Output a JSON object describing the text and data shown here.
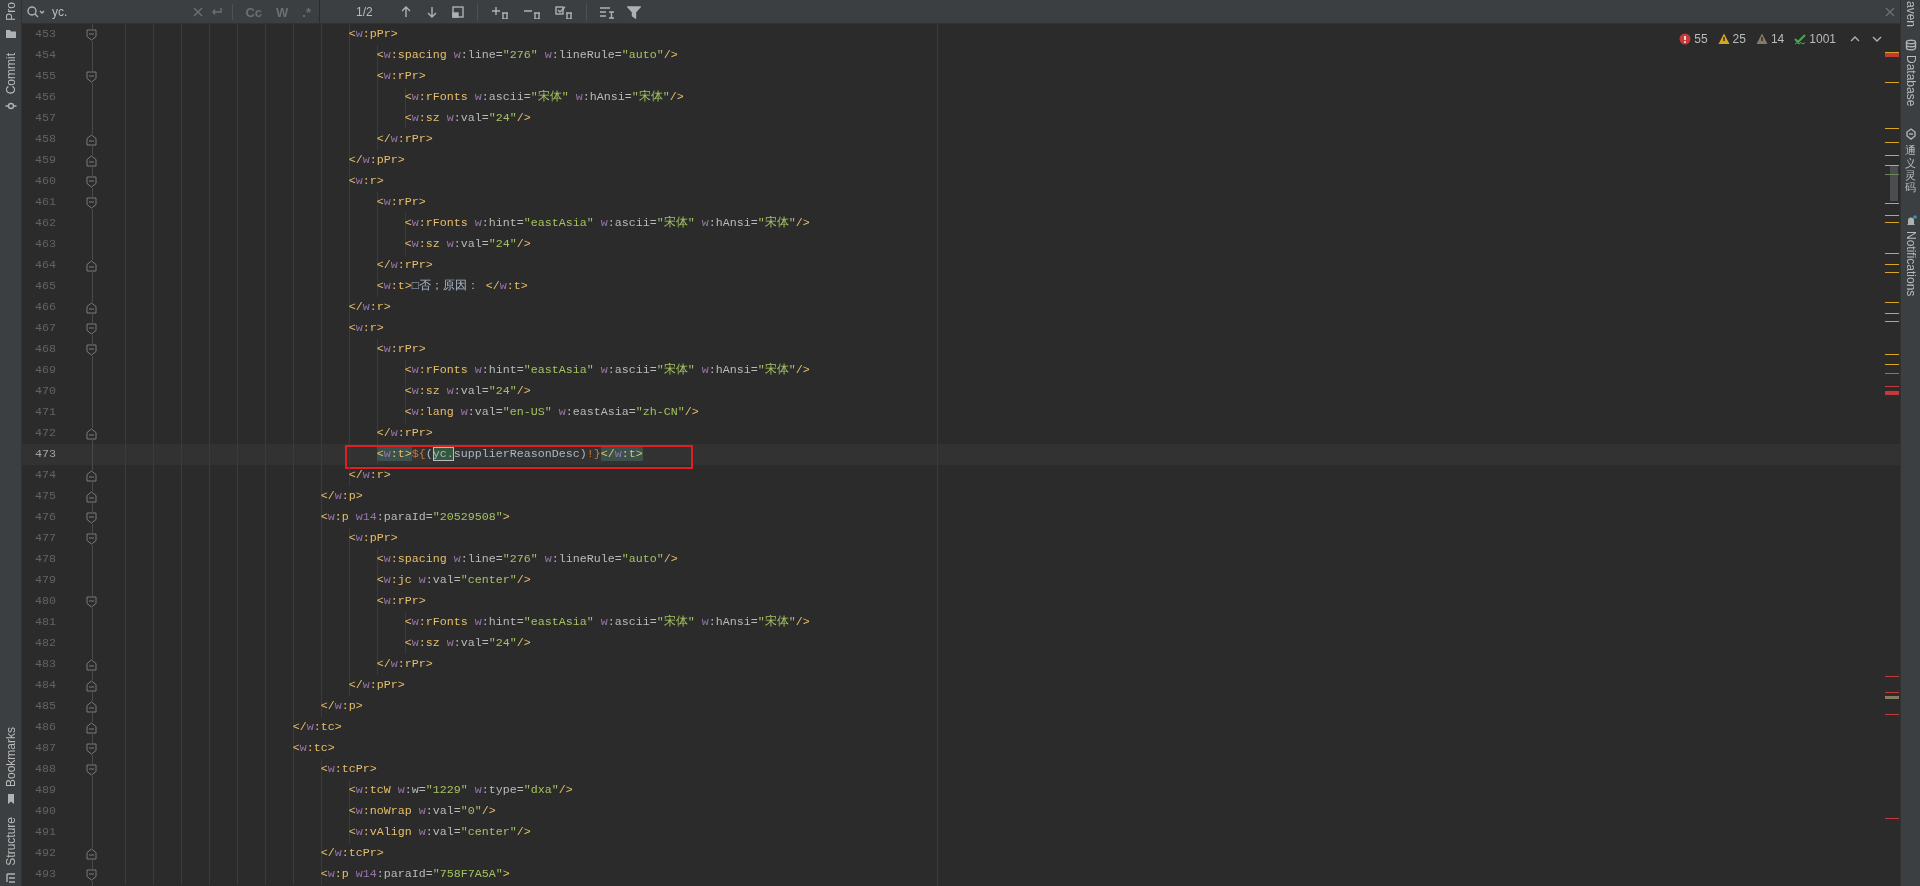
{
  "left_toolbar": {
    "top": [
      {
        "kind": "project",
        "label": "Pro"
      },
      {
        "kind": "commit",
        "label": "Commit"
      }
    ],
    "bottom": [
      {
        "kind": "bookmarks",
        "label": "Bookmarks"
      },
      {
        "kind": "structure",
        "label": "Structure"
      }
    ]
  },
  "right_toolbar": [
    {
      "kind": "maven",
      "label": "aven"
    },
    {
      "kind": "database",
      "label": "Database"
    },
    {
      "kind": "assistant",
      "label": "通义灵码"
    },
    {
      "kind": "notifications",
      "label": "Notifications"
    }
  ],
  "search_bar": {
    "value": "yc.",
    "options": [
      {
        "label": "Cc",
        "selected": false
      },
      {
        "label": "W",
        "selected": false
      },
      {
        "label": ".*",
        "selected": false
      }
    ],
    "match_count": "1/2"
  },
  "inspections": [
    {
      "kind": "error",
      "count": "55"
    },
    {
      "kind": "warning",
      "count": "25"
    },
    {
      "kind": "weak_warning",
      "count": "14"
    },
    {
      "kind": "typo",
      "count": "1001"
    }
  ],
  "lines": [
    {
      "number": "453",
      "fold_start": true,
      "fold_end": false,
      "current": false,
      "segments": [
        {
          "kind": "code",
          "text": "                                    <w:pPr>"
        }
      ]
    },
    {
      "number": "454",
      "fold_start": false,
      "fold_end": false,
      "current": false,
      "segments": [
        {
          "kind": "code",
          "text": "                                        <w:spacing w:line=\"276\" w:lineRule=\"auto\"/>"
        }
      ]
    },
    {
      "number": "455",
      "fold_start": true,
      "fold_end": false,
      "current": false,
      "segments": [
        {
          "kind": "code",
          "text": "                                        <w:rPr>"
        }
      ]
    },
    {
      "number": "456",
      "fold_start": false,
      "fold_end": false,
      "current": false,
      "segments": [
        {
          "kind": "code",
          "text": "                                            <w:rFonts w:ascii=\"宋体\" w:hAnsi=\"宋体\"/>"
        }
      ]
    },
    {
      "number": "457",
      "fold_start": false,
      "fold_end": false,
      "current": false,
      "segments": [
        {
          "kind": "code",
          "text": "                                            <w:sz w:val=\"24\"/>"
        }
      ]
    },
    {
      "number": "458",
      "fold_start": false,
      "fold_end": true,
      "current": false,
      "segments": [
        {
          "kind": "code",
          "text": "                                        </w:rPr>"
        }
      ]
    },
    {
      "number": "459",
      "fold_start": false,
      "fold_end": true,
      "current": false,
      "segments": [
        {
          "kind": "code",
          "text": "                                    </w:pPr>"
        }
      ]
    },
    {
      "number": "460",
      "fold_start": true,
      "fold_end": false,
      "current": false,
      "segments": [
        {
          "kind": "code",
          "text": "                                    <w:r>"
        }
      ]
    },
    {
      "number": "461",
      "fold_start": true,
      "fold_end": false,
      "current": false,
      "segments": [
        {
          "kind": "code",
          "text": "                                        <w:rPr>"
        }
      ]
    },
    {
      "number": "462",
      "fold_start": false,
      "fold_end": false,
      "current": false,
      "segments": [
        {
          "kind": "code",
          "text": "                                            <w:rFonts w:hint=\"eastAsia\" w:ascii=\"宋体\" w:hAnsi=\"宋体\"/>"
        }
      ]
    },
    {
      "number": "463",
      "fold_start": false,
      "fold_end": false,
      "current": false,
      "segments": [
        {
          "kind": "code",
          "text": "                                            <w:sz w:val=\"24\"/>"
        }
      ]
    },
    {
      "number": "464",
      "fold_start": false,
      "fold_end": true,
      "current": false,
      "segments": [
        {
          "kind": "code",
          "text": "                                        </w:rPr>"
        }
      ]
    },
    {
      "number": "465",
      "fold_start": false,
      "fold_end": false,
      "current": false,
      "segments": [
        {
          "kind": "code",
          "text": "                                        <w:t>□否；原因： </w:t>"
        }
      ]
    },
    {
      "number": "466",
      "fold_start": false,
      "fold_end": true,
      "current": false,
      "segments": [
        {
          "kind": "code",
          "text": "                                    </w:r>"
        }
      ]
    },
    {
      "number": "467",
      "fold_start": true,
      "fold_end": false,
      "current": false,
      "segments": [
        {
          "kind": "code",
          "text": "                                    <w:r>"
        }
      ]
    },
    {
      "number": "468",
      "fold_start": true,
      "fold_end": false,
      "current": false,
      "segments": [
        {
          "kind": "code",
          "text": "                                        <w:rPr>"
        }
      ]
    },
    {
      "number": "469",
      "fold_start": false,
      "fold_end": false,
      "current": false,
      "segments": [
        {
          "kind": "code",
          "text": "                                            <w:rFonts w:hint=\"eastAsia\" w:ascii=\"宋体\" w:hAnsi=\"宋体\"/>"
        }
      ]
    },
    {
      "number": "470",
      "fold_start": false,
      "fold_end": false,
      "current": false,
      "segments": [
        {
          "kind": "code",
          "text": "                                            <w:sz w:val=\"24\"/>"
        }
      ]
    },
    {
      "number": "471",
      "fold_start": false,
      "fold_end": false,
      "current": false,
      "segments": [
        {
          "kind": "code",
          "text": "                                            <w:lang w:val=\"en-US\" w:eastAsia=\"zh-CN\"/>"
        }
      ]
    },
    {
      "number": "472",
      "fold_start": false,
      "fold_end": true,
      "current": false,
      "segments": [
        {
          "kind": "code",
          "text": "                                        </w:rPr>"
        }
      ]
    },
    {
      "number": "473",
      "fold_start": false,
      "fold_end": false,
      "current": true,
      "boxed": true,
      "segments": [
        {
          "kind": "matched_tag",
          "text": "                                        <w:t>"
        },
        {
          "kind": "code",
          "text": "${("
        },
        {
          "kind": "search_match",
          "text": "yc."
        },
        {
          "kind": "code",
          "text": "supplierReasonDesc)!}"
        },
        {
          "kind": "matched_tag",
          "text": "</w:t>"
        }
      ]
    },
    {
      "number": "474",
      "fold_start": false,
      "fold_end": true,
      "current": false,
      "segments": [
        {
          "kind": "code",
          "text": "                                    </w:r>"
        }
      ]
    },
    {
      "number": "475",
      "fold_start": false,
      "fold_end": true,
      "current": false,
      "segments": [
        {
          "kind": "code",
          "text": "                                </w:p>"
        }
      ]
    },
    {
      "number": "476",
      "fold_start": true,
      "fold_end": false,
      "current": false,
      "segments": [
        {
          "kind": "code",
          "text": "                                <w:p w14:paraId=\"20529508\">"
        }
      ]
    },
    {
      "number": "477",
      "fold_start": true,
      "fold_end": false,
      "current": false,
      "segments": [
        {
          "kind": "code",
          "text": "                                    <w:pPr>"
        }
      ]
    },
    {
      "number": "478",
      "fold_start": false,
      "fold_end": false,
      "current": false,
      "segments": [
        {
          "kind": "code",
          "text": "                                        <w:spacing w:line=\"276\" w:lineRule=\"auto\"/>"
        }
      ]
    },
    {
      "number": "479",
      "fold_start": false,
      "fold_end": false,
      "current": false,
      "segments": [
        {
          "kind": "code",
          "text": "                                        <w:jc w:val=\"center\"/>"
        }
      ]
    },
    {
      "number": "480",
      "fold_start": true,
      "fold_end": false,
      "current": false,
      "segments": [
        {
          "kind": "code",
          "text": "                                        <w:rPr>"
        }
      ]
    },
    {
      "number": "481",
      "fold_start": false,
      "fold_end": false,
      "current": false,
      "segments": [
        {
          "kind": "code",
          "text": "                                            <w:rFonts w:hint=\"eastAsia\" w:ascii=\"宋体\" w:hAnsi=\"宋体\"/>"
        }
      ]
    },
    {
      "number": "482",
      "fold_start": false,
      "fold_end": false,
      "current": false,
      "segments": [
        {
          "kind": "code",
          "text": "                                            <w:sz w:val=\"24\"/>"
        }
      ]
    },
    {
      "number": "483",
      "fold_start": false,
      "fold_end": true,
      "current": false,
      "segments": [
        {
          "kind": "code",
          "text": "                                        </w:rPr>"
        }
      ]
    },
    {
      "number": "484",
      "fold_start": false,
      "fold_end": true,
      "current": false,
      "segments": [
        {
          "kind": "code",
          "text": "                                    </w:pPr>"
        }
      ]
    },
    {
      "number": "485",
      "fold_start": false,
      "fold_end": true,
      "current": false,
      "segments": [
        {
          "kind": "code",
          "text": "                                </w:p>"
        }
      ]
    },
    {
      "number": "486",
      "fold_start": false,
      "fold_end": true,
      "current": false,
      "segments": [
        {
          "kind": "code",
          "text": "                            </w:tc>"
        }
      ]
    },
    {
      "number": "487",
      "fold_start": true,
      "fold_end": false,
      "current": false,
      "segments": [
        {
          "kind": "code",
          "text": "                            <w:tc>"
        }
      ]
    },
    {
      "number": "488",
      "fold_start": true,
      "fold_end": false,
      "current": false,
      "segments": [
        {
          "kind": "code",
          "text": "                                <w:tcPr>"
        }
      ]
    },
    {
      "number": "489",
      "fold_start": false,
      "fold_end": false,
      "current": false,
      "segments": [
        {
          "kind": "code",
          "text": "                                    <w:tcW w:w=\"1229\" w:type=\"dxa\"/>"
        }
      ]
    },
    {
      "number": "490",
      "fold_start": false,
      "fold_end": false,
      "current": false,
      "segments": [
        {
          "kind": "code",
          "text": "                                    <w:noWrap w:val=\"0\"/>"
        }
      ]
    },
    {
      "number": "491",
      "fold_start": false,
      "fold_end": false,
      "current": false,
      "segments": [
        {
          "kind": "code",
          "text": "                                    <w:vAlign w:val=\"center\"/>"
        }
      ]
    },
    {
      "number": "492",
      "fold_start": false,
      "fold_end": true,
      "current": false,
      "segments": [
        {
          "kind": "code",
          "text": "                                </w:tcPr>"
        }
      ]
    },
    {
      "number": "493",
      "fold_start": true,
      "fold_end": false,
      "current": false,
      "segments": [
        {
          "kind": "code",
          "text": "                                <w:p w14:paraId=\"758F7A5A\">"
        }
      ]
    }
  ]
}
